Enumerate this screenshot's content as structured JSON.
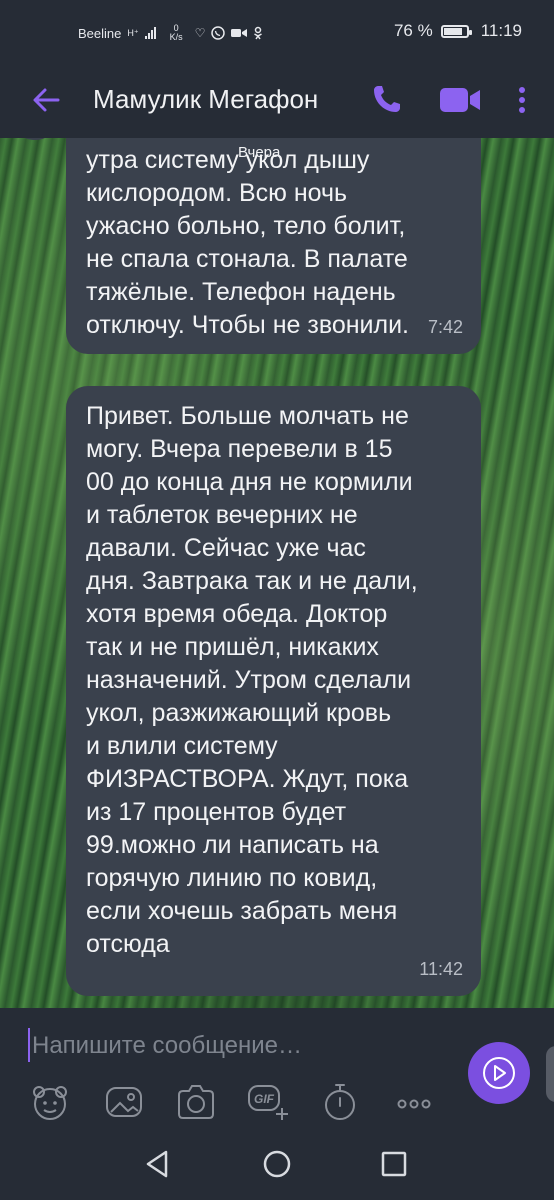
{
  "status_bar": {
    "carrier": "Beeline",
    "network_type": "H⁺",
    "speed_value": "0",
    "speed_unit": "K/s",
    "battery": "76 %",
    "battery_level": 0.76,
    "time": "11:19",
    "notification_icons": [
      "heart-pulse-icon",
      "viber-icon",
      "video-camera-icon",
      "odnoklassniki-icon"
    ]
  },
  "header": {
    "contact_name": "Мамулик Мегафон",
    "accent_color": "#8c63f0"
  },
  "chat": {
    "date_divider": "Вчера",
    "messages": [
      {
        "text": "утра систему укол дышу\nкислородом. Всю ночь\nужасно больно, тело болит,\nне спала стонала. В палате\nтяжёлые. Телефон надень\nотключу. Чтобы не звонили.",
        "time": "7:42"
      },
      {
        "text": "Привет. Больше молчать не\nмогу. Вчера перевели в 15\n00 до конца дня не кормили\nи таблеток вечерних не\nдавали. Сейчас уже час\nдня. Завтрака так и не дали,\nхотя время обеда. Доктор\nтак и не пришёл, никаких\nназначений. Утром сделали\nукол, разжижающий кровь\nи влили систему\nФИЗРАСТВОРА. Ждут, пока\nиз 17 процентов будет\n99.можно ли написать на\nгорячую линию по ковид,\nесли хочешь забрать меня\nотсюда",
        "time": "11:42"
      }
    ]
  },
  "composer": {
    "placeholder": "Напишите сообщение…",
    "value": "",
    "tools": [
      "sticker-icon",
      "gallery-icon",
      "camera-icon",
      "gif-icon",
      "timer-icon",
      "more-icon"
    ],
    "gif_label": "GIF"
  }
}
